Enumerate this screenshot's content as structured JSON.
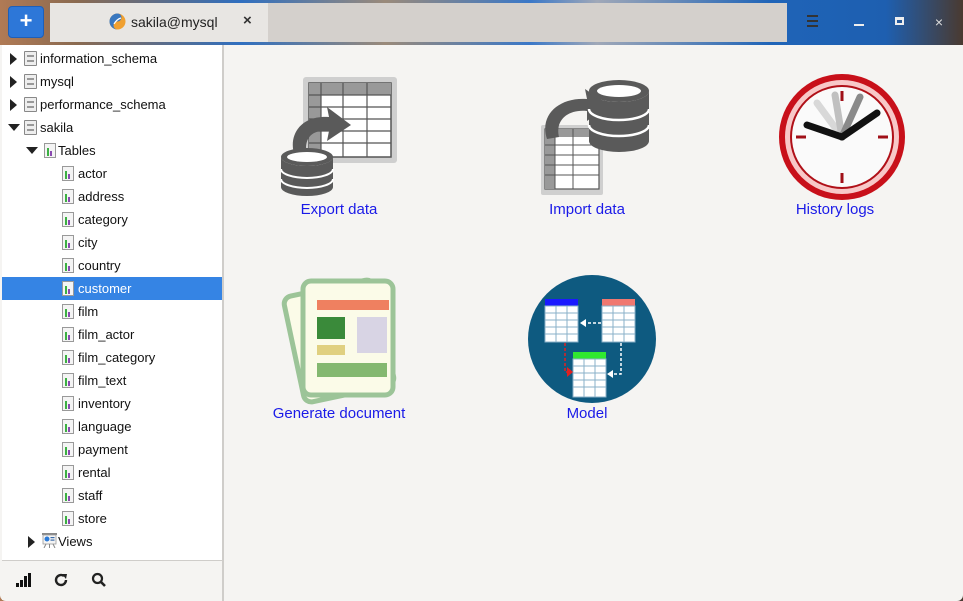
{
  "titlebar": {
    "new_tab_label": "+",
    "tab": {
      "title": "sakila@mysql",
      "close_label": "×",
      "icon": "database-connection-icon"
    },
    "controls": {
      "menu": "menu-icon",
      "minimize": "minimize-icon",
      "maximize": "maximize-icon",
      "close_label": "×"
    }
  },
  "sidebar": {
    "tree": [
      {
        "label": "information_schema",
        "type": "database",
        "expanded": false
      },
      {
        "label": "mysql",
        "type": "database",
        "expanded": false
      },
      {
        "label": "performance_schema",
        "type": "database",
        "expanded": false
      },
      {
        "label": "sakila",
        "type": "database",
        "expanded": true
      },
      {
        "label": "Tables",
        "type": "folder",
        "expanded": true
      },
      {
        "label": "actor",
        "type": "table"
      },
      {
        "label": "address",
        "type": "table"
      },
      {
        "label": "category",
        "type": "table"
      },
      {
        "label": "city",
        "type": "table"
      },
      {
        "label": "country",
        "type": "table"
      },
      {
        "label": "customer",
        "type": "table",
        "selected": true
      },
      {
        "label": "film",
        "type": "table"
      },
      {
        "label": "film_actor",
        "type": "table"
      },
      {
        "label": "film_category",
        "type": "table"
      },
      {
        "label": "film_text",
        "type": "table"
      },
      {
        "label": "inventory",
        "type": "table"
      },
      {
        "label": "language",
        "type": "table"
      },
      {
        "label": "payment",
        "type": "table"
      },
      {
        "label": "rental",
        "type": "table"
      },
      {
        "label": "staff",
        "type": "table"
      },
      {
        "label": "store",
        "type": "table"
      },
      {
        "label": "Views",
        "type": "views",
        "expanded": false
      }
    ],
    "footer": {
      "buttons": [
        "signal-bars-icon",
        "refresh-icon",
        "search-icon"
      ]
    }
  },
  "main": {
    "tiles": [
      {
        "label": "Export data",
        "icon": "export-data-icon"
      },
      {
        "label": "Import data",
        "icon": "import-data-icon"
      },
      {
        "label": "History logs",
        "icon": "clock-icon"
      },
      {
        "label": "Generate document",
        "icon": "document-icon"
      },
      {
        "label": "Model",
        "icon": "model-diagram-icon"
      }
    ]
  },
  "colors": {
    "accent": "#3584e4",
    "link": "#1a1ae8",
    "new_tab_button": "#2d77d8"
  }
}
